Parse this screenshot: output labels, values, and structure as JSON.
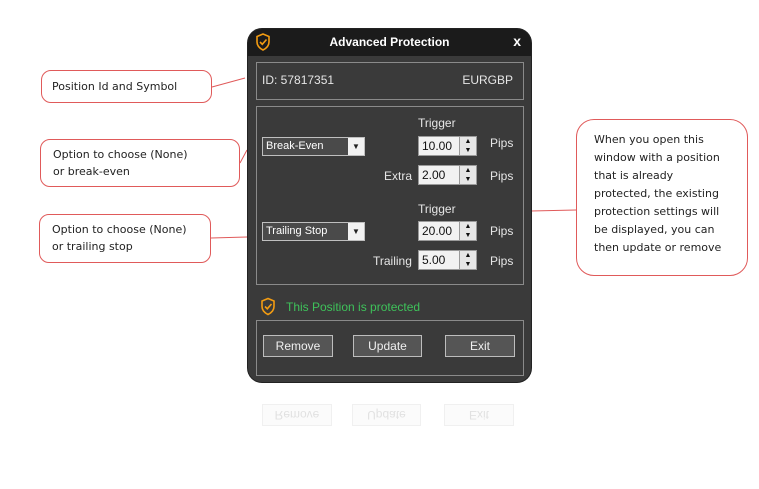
{
  "callouts": {
    "position": "Position Id and Symbol",
    "break_even": [
      "Option to choose (None)",
      "or break-even"
    ],
    "trailing": [
      "Option to choose (None)",
      "or trailing stop"
    ],
    "info": [
      "When you open this",
      "window with a position",
      "that is already",
      "protected, the existing",
      "protection settings will",
      "be displayed, you can",
      "then update or remove"
    ]
  },
  "window": {
    "title": "Advanced Protection",
    "close_label": "x"
  },
  "position": {
    "id_label": "ID: 57817351",
    "symbol": "EURGBP"
  },
  "break_even": {
    "trigger_label": "Trigger",
    "select_value": "Break-Even",
    "trigger_value": "10.00",
    "trigger_unit": "Pips",
    "extra_label": "Extra",
    "extra_value": "2.00",
    "extra_unit": "Pips"
  },
  "trailing": {
    "trigger_label": "Trigger",
    "select_value": "Trailing Stop",
    "trigger_value": "20.00",
    "trigger_unit": "Pips",
    "trailing_label": "Trailing",
    "trailing_value": "5.00",
    "trailing_unit": "Pips"
  },
  "status": {
    "text": "This Position is protected",
    "icon": "shield-check-icon",
    "color": "#3ec25a"
  },
  "buttons": {
    "remove": "Remove",
    "update": "Update",
    "exit": "Exit"
  },
  "colors": {
    "accent": "#f39c12",
    "callout_border": "#e05a5a",
    "window_bg": "#3a3a3a"
  }
}
